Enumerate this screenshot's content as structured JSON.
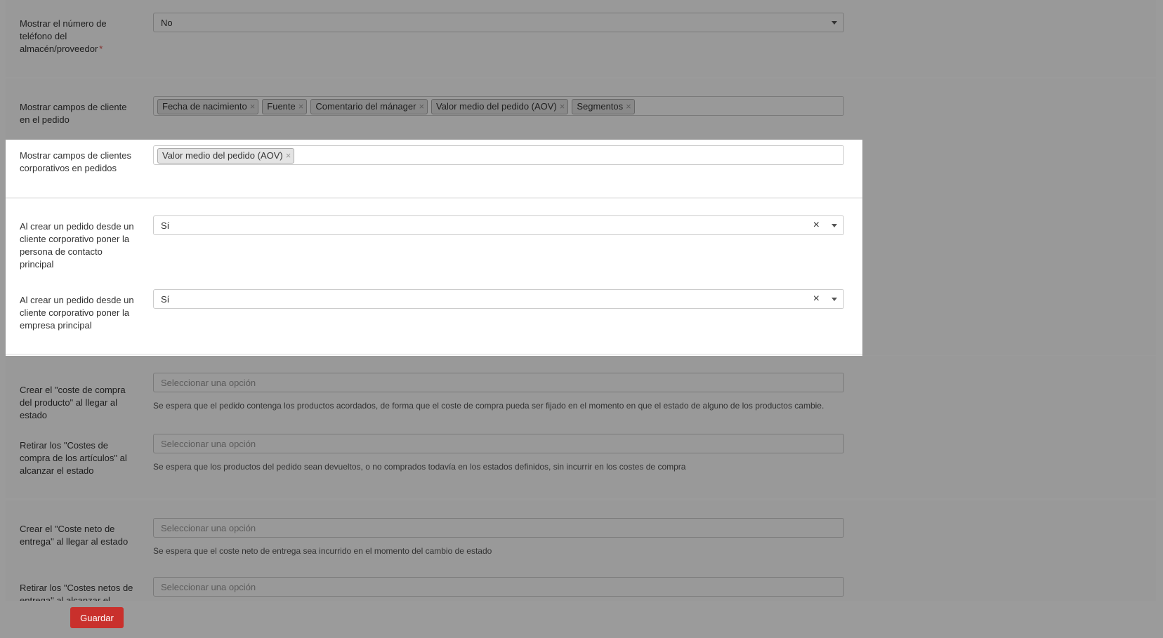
{
  "section_phone": {
    "label": "Mostrar el número de teléfono del almacén/proveedor",
    "required_mark": "*",
    "value": "No"
  },
  "section_customer_fields": {
    "label": "Mostrar campos de cliente en el pedido",
    "tags": [
      "Fecha de nacimiento",
      "Fuente",
      "Comentario del mánager",
      "Valor medio del pedido (AOV)",
      "Segmentos"
    ]
  },
  "section_corporate_fields": {
    "label": "Mostrar campos de clientes corporativos en pedidos",
    "tags": [
      "Valor medio del pedido (AOV)"
    ]
  },
  "section_corporate_defaults": {
    "contact_label": "Al crear un pedido desde un cliente corporativo poner la persona de contacto principal",
    "contact_value": "Sí",
    "company_label": "Al crear un pedido desde un cliente corporativo poner la empresa principal",
    "company_value": "Sí"
  },
  "section_purchase_costs": {
    "create_label": "Crear el \"coste de compra del producto\" al llegar al estado",
    "create_placeholder": "Seleccionar una opción",
    "create_help": "Se espera que el pedido contenga los productos acordados, de forma que el coste de compra pueda ser fijado en el momento en que el estado de alguno de los productos cambie.",
    "remove_label": "Retirar los \"Costes de compra de los artículos\" al alcanzar el estado",
    "remove_placeholder": "Seleccionar una opción",
    "remove_help": "Se espera que los productos del pedido sean devueltos, o no comprados todavía en los estados definidos, sin incurrir en los costes de compra"
  },
  "section_delivery_costs": {
    "create_label": "Crear el \"Coste neto de entrega\" al llegar al estado",
    "create_placeholder": "Seleccionar una opción",
    "create_help": "Se espera que el coste neto de entrega sea incurrido en el momento del cambio de estado",
    "remove_label": "Retirar los \"Costes netos de entrega\" al alcanzar el estado",
    "remove_placeholder": "Seleccionar una opción"
  },
  "footer": {
    "save_label": "Guardar"
  },
  "colors": {
    "save_button": "#c9302c",
    "required": "#d9534f"
  }
}
